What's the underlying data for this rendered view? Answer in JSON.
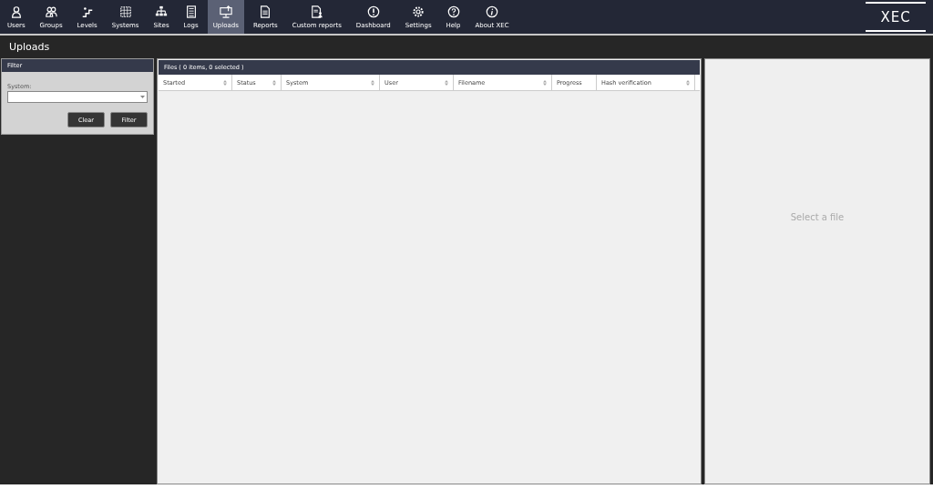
{
  "nav": {
    "items": [
      {
        "label": "Users",
        "selected": false
      },
      {
        "label": "Groups",
        "selected": false
      },
      {
        "label": "Levels",
        "selected": false
      },
      {
        "label": "Systems",
        "selected": false
      },
      {
        "label": "Sites",
        "selected": false
      },
      {
        "label": "Logs",
        "selected": false
      },
      {
        "label": "Uploads",
        "selected": true
      },
      {
        "label": "Reports",
        "selected": false
      },
      {
        "label": "Custom reports",
        "selected": false
      },
      {
        "label": "Dashboard",
        "selected": false
      },
      {
        "label": "Settings",
        "selected": false
      },
      {
        "label": "Help",
        "selected": false
      },
      {
        "label": "About XEC",
        "selected": false
      }
    ],
    "logo": "XEC"
  },
  "page_title": "Uploads",
  "filter": {
    "title": "Filter",
    "system_label": "System:",
    "buttons": [
      "Clear",
      "Filter"
    ]
  },
  "files": {
    "title": "Files ( 0  items, 0 selected )",
    "columns": [
      {
        "label": "Started",
        "sortable": true
      },
      {
        "label": "Status",
        "sortable": true
      },
      {
        "label": "System",
        "sortable": true
      },
      {
        "label": "User",
        "sortable": true
      },
      {
        "label": "Filename",
        "sortable": true
      },
      {
        "label": "Progress",
        "sortable": false
      },
      {
        "label": "Hash verification",
        "sortable": true
      }
    ]
  },
  "detail": {
    "empty_text": "Select a file"
  }
}
